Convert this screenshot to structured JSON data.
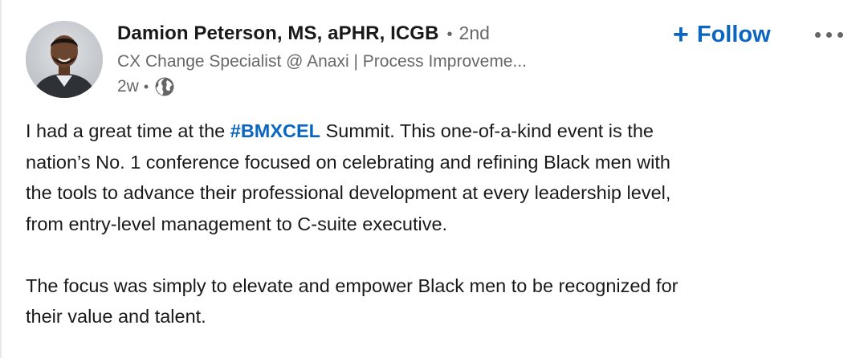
{
  "author": {
    "name": "Damion Peterson, MS, aPHR, ICGB",
    "separator": "•",
    "degree": "2nd",
    "headline": "CX Change Specialist @ Anaxi | Process Improveme...",
    "time": "2w",
    "time_separator": "•",
    "visibility_icon": "globe-icon",
    "avatar_icon": "profile-photo"
  },
  "actions": {
    "follow_plus": "+",
    "follow_label": "Follow",
    "more_icon": "more-horizontal-icon"
  },
  "post": {
    "para1": {
      "line1_before": "I had a great time at the ",
      "hashtag": "#BMXCEL",
      "line1_after": " Summit. This one-of-a-kind event is the",
      "line2": "nation’s No. 1 conference focused on celebrating and refining Black men with",
      "line3": "the tools to advance their professional development at every leadership level,",
      "line4": "from entry-level management to C-suite executive."
    },
    "para2": {
      "line1": "The focus was simply to elevate and empower Black men to be recognized for",
      "line2": "their value and talent."
    }
  },
  "colors": {
    "link_blue": "#0a66c2",
    "text_primary": "#191919",
    "text_secondary": "#666666"
  }
}
